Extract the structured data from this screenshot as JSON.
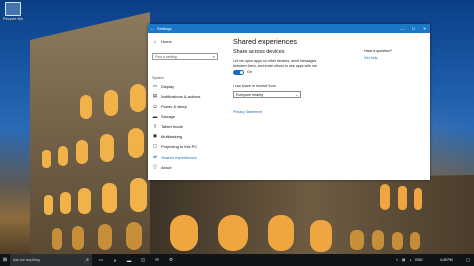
{
  "desktop": {
    "icon_label": "Recycle Bin"
  },
  "window": {
    "title": "Settings",
    "back_glyph": "←",
    "minimize_glyph": "—",
    "maximize_glyph": "☐",
    "close_glyph": "✕"
  },
  "sidebar": {
    "home_label": "Home",
    "search_placeholder": "Find a setting",
    "section_label": "System",
    "items": [
      {
        "label": "Display",
        "icon": "display-icon"
      },
      {
        "label": "Notifications & actions",
        "icon": "notifications-icon"
      },
      {
        "label": "Power & sleep",
        "icon": "power-icon"
      },
      {
        "label": "Storage",
        "icon": "storage-icon"
      },
      {
        "label": "Tablet mode",
        "icon": "tablet-icon"
      },
      {
        "label": "Multitasking",
        "icon": "multitasking-icon"
      },
      {
        "label": "Projecting to this PC",
        "icon": "projecting-icon"
      },
      {
        "label": "Shared experiences",
        "icon": "shared-experiences-icon"
      },
      {
        "label": "About",
        "icon": "about-icon"
      }
    ],
    "active_index": 7
  },
  "content": {
    "page_title": "Shared experiences",
    "section_title": "Share across devices",
    "description": "Let me open apps on other devices, send messages between them, and invite others to use apps with me",
    "toggle_state": "On",
    "toggle_on": true,
    "share_label": "I can share or receive from",
    "dropdown_value": "Everyone nearby",
    "privacy_link": "Privacy Statement"
  },
  "help": {
    "question": "Have a question?",
    "link": "Get help"
  },
  "taskbar": {
    "search_placeholder": "Ask me anything",
    "clock": "4:49 PM",
    "lang": "ENG"
  },
  "colors": {
    "accent": "#1a78c6",
    "link": "#1a6cc0",
    "taskbar": "#101418"
  }
}
